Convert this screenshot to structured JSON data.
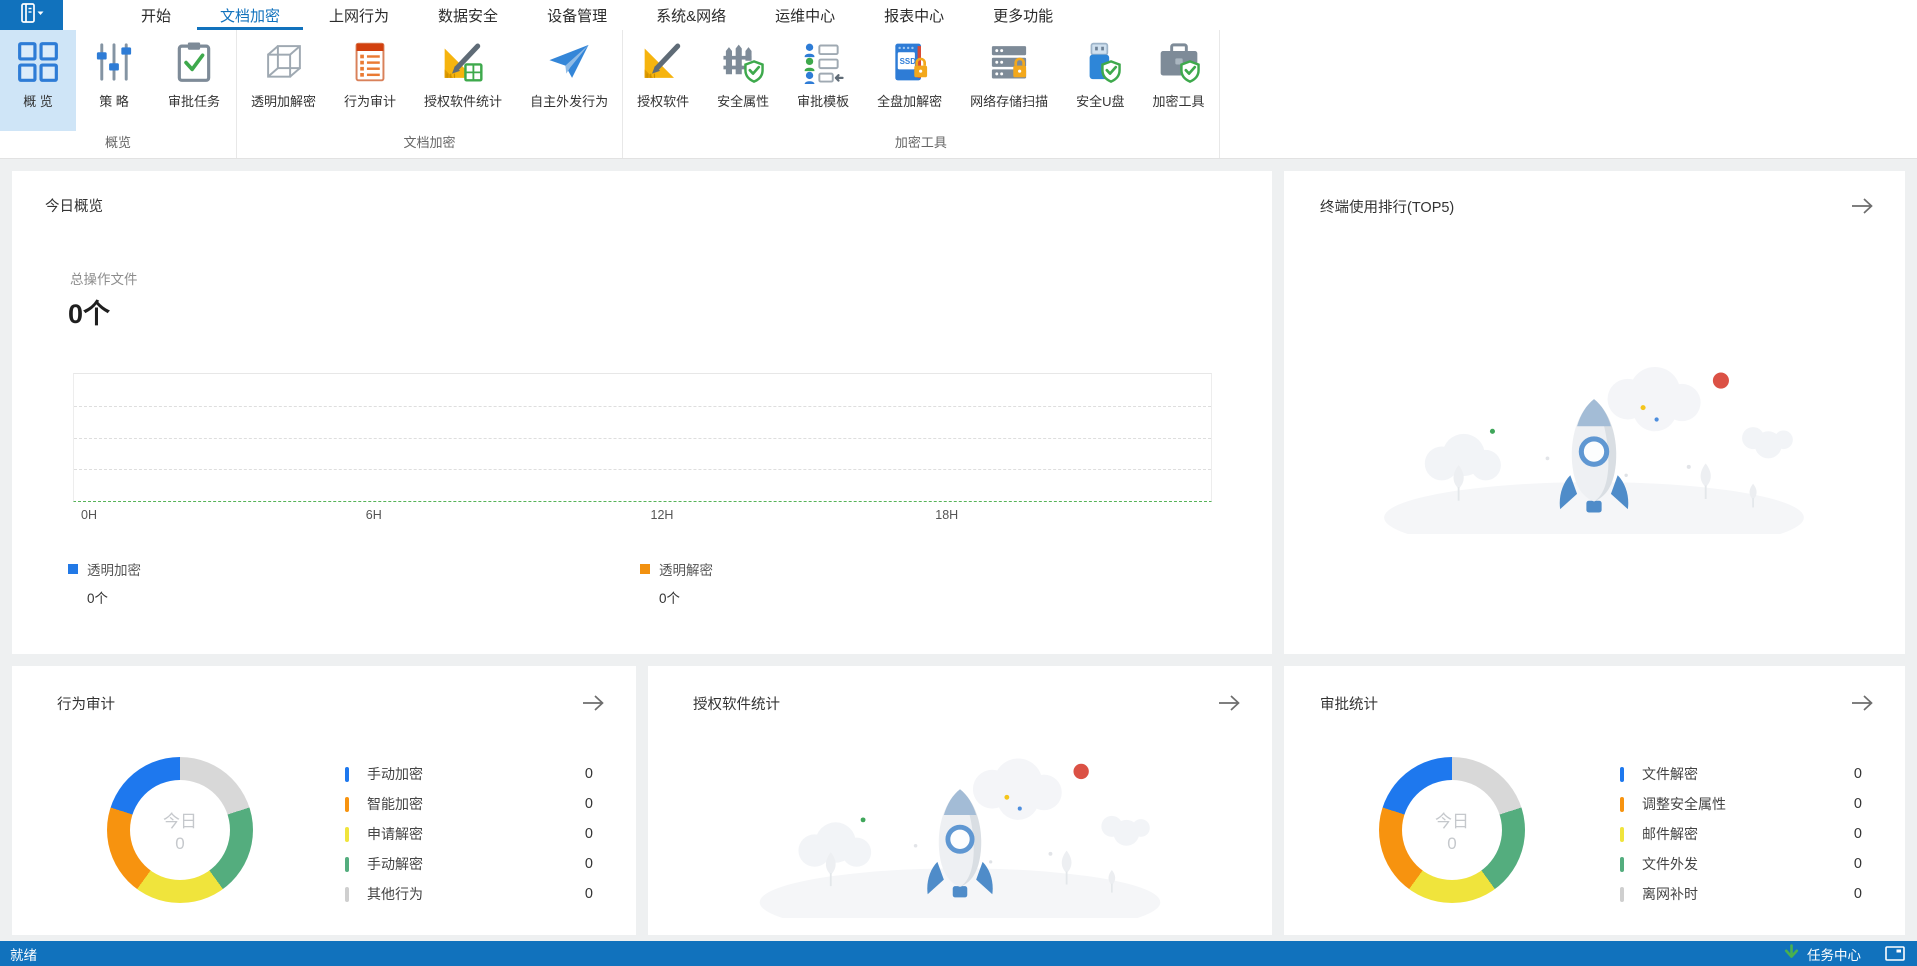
{
  "colors": {
    "accent_blue": "#1172bd",
    "ribbon_selected_bg": "#cfe5f7",
    "page_bg": "#eef0f1",
    "chart_baseline_green": "#56b358",
    "donut_blue": "#1e78ee",
    "donut_orange": "#f7930f",
    "donut_yellow": "#f0e43c",
    "donut_green": "#54ad7e",
    "donut_gray": "#d8d8d8",
    "empty_state_red_dot": "#db5145"
  },
  "menu": {
    "app_button": {
      "icon": "app-menu-icon"
    },
    "tabs": [
      {
        "name": "tab-start",
        "label": "开始",
        "active": false
      },
      {
        "name": "tab-doc-encryption",
        "label": "文档加密",
        "active": true
      },
      {
        "name": "tab-internet-behavior",
        "label": "上网行为",
        "active": false
      },
      {
        "name": "tab-data-security",
        "label": "数据安全",
        "active": false
      },
      {
        "name": "tab-device-mgmt",
        "label": "设备管理",
        "active": false
      },
      {
        "name": "tab-system-network",
        "label": "系统&网络",
        "active": false
      },
      {
        "name": "tab-ops-center",
        "label": "运维中心",
        "active": false
      },
      {
        "name": "tab-report-center",
        "label": "报表中心",
        "active": false
      },
      {
        "name": "tab-more-features",
        "label": "更多功能",
        "active": false
      }
    ]
  },
  "ribbon": {
    "groups": [
      {
        "label": "概览",
        "items": [
          {
            "name": "overview",
            "label": "概 览",
            "icon": "overview-icon",
            "selected": true
          },
          {
            "name": "policy",
            "label": "策 略",
            "icon": "policy-sliders-icon",
            "selected": false
          },
          {
            "name": "approval-task",
            "label": "审批任务",
            "icon": "approval-task-icon",
            "selected": false
          }
        ]
      },
      {
        "label": "文档加密",
        "items": [
          {
            "name": "transparent-crypt",
            "label": "透明加解密",
            "icon": "transparent-crypt-cube-icon",
            "selected": false
          },
          {
            "name": "behavior-audit",
            "label": "行为审计",
            "icon": "behavior-audit-doc-icon",
            "selected": false
          },
          {
            "name": "authorized-software-stats",
            "label": "授权软件统计",
            "icon": "authorized-software-stats-icon",
            "selected": false
          },
          {
            "name": "self-outgoing",
            "label": "自主外发行为",
            "icon": "outgoing-plane-icon",
            "selected": false
          }
        ]
      },
      {
        "label": "加密工具",
        "items": [
          {
            "name": "authorized-software",
            "label": "授权软件",
            "icon": "authorized-software-icon",
            "selected": false
          },
          {
            "name": "security-attribute",
            "label": "安全属性",
            "icon": "security-attribute-fence-icon",
            "selected": false
          },
          {
            "name": "approval-template",
            "label": "审批模板",
            "icon": "approval-template-icon",
            "selected": false
          },
          {
            "name": "full-disk-crypt",
            "label": "全盘加解密",
            "icon": "full-disk-crypt-icon",
            "selected": false
          },
          {
            "name": "network-storage-scan",
            "label": "网络存储扫描",
            "icon": "network-storage-scan-icon",
            "selected": false
          },
          {
            "name": "secure-usb",
            "label": "安全U盘",
            "icon": "secure-usb-icon",
            "selected": false
          },
          {
            "name": "crypt-tools",
            "label": "加密工具",
            "icon": "crypt-tools-icon",
            "selected": false
          }
        ]
      }
    ]
  },
  "cards": {
    "today_overview": {
      "title": "今日概览",
      "stat": {
        "label": "总操作文件",
        "value": "0个"
      },
      "chart": {
        "x_ticks": [
          "0H",
          "6H",
          "12H",
          "18H"
        ]
      },
      "legend": [
        {
          "label": "透明加密",
          "value": "0个",
          "color": "#2279e6"
        },
        {
          "label": "透明解密",
          "value": "0个",
          "color": "#f29110"
        }
      ]
    },
    "terminal_rank": {
      "title": "终端使用排行(TOP5)"
    },
    "behavior_audit": {
      "title": "行为审计",
      "donut": {
        "center_label": "今日",
        "center_value": "0",
        "segments": [
          {
            "color": "#d8d8d8",
            "sweep": 72
          },
          {
            "color": "#54ad7e",
            "sweep": 72
          },
          {
            "color": "#f0e43c",
            "sweep": 72
          },
          {
            "color": "#f7930f",
            "sweep": 72
          },
          {
            "color": "#1e78ee",
            "sweep": 72
          }
        ]
      },
      "legend": [
        {
          "label": "手动加密",
          "value": "0",
          "color": "#1e78ee"
        },
        {
          "label": "智能加密",
          "value": "0",
          "color": "#f7930f"
        },
        {
          "label": "申请解密",
          "value": "0",
          "color": "#f0e43c"
        },
        {
          "label": "手动解密",
          "value": "0",
          "color": "#54ad7e"
        },
        {
          "label": "其他行为",
          "value": "0",
          "color": "#cfcfcf"
        }
      ]
    },
    "software_stats": {
      "title": "授权软件统计"
    },
    "approval_stats": {
      "title": "审批统计",
      "donut": {
        "center_label": "今日",
        "center_value": "0",
        "segments": [
          {
            "color": "#d8d8d8",
            "sweep": 72
          },
          {
            "color": "#54ad7e",
            "sweep": 72
          },
          {
            "color": "#f0e43c",
            "sweep": 72
          },
          {
            "color": "#f7930f",
            "sweep": 72
          },
          {
            "color": "#1e78ee",
            "sweep": 72
          }
        ]
      },
      "legend": [
        {
          "label": "文件解密",
          "value": "0",
          "color": "#1e78ee"
        },
        {
          "label": "调整安全属性",
          "value": "0",
          "color": "#f7930f"
        },
        {
          "label": "邮件解密",
          "value": "0",
          "color": "#f0e43c"
        },
        {
          "label": "文件外发",
          "value": "0",
          "color": "#54ad7e"
        },
        {
          "label": "离网补时",
          "value": "0",
          "color": "#cfcfcf"
        }
      ]
    }
  },
  "statusbar": {
    "status_text": "就绪",
    "task_center_label": "任务中心"
  },
  "chart_data": [
    {
      "type": "line",
      "title": "今日概览",
      "xlabel": "hour of day",
      "x_ticks": [
        "0H",
        "6H",
        "12H",
        "18H"
      ],
      "x_range_hours": [
        0,
        24
      ],
      "series": [
        {
          "name": "透明加密",
          "values": [],
          "total": "0个"
        },
        {
          "name": "透明解密",
          "values": [],
          "total": "0个"
        }
      ],
      "grid": "horizontal-dashed",
      "note": "empty chart, flat green dashed baseline at zero, 总操作文件 = 0个"
    },
    {
      "type": "pie",
      "title": "行为审计",
      "center_label": "今日",
      "center_value": 0,
      "categories": [
        "手动加密",
        "智能加密",
        "申请解密",
        "手动解密",
        "其他行为"
      ],
      "values": [
        0,
        0,
        0,
        0,
        0
      ],
      "display": "five equal 72° placeholder segments (blue, orange, yellow, green, gray)"
    },
    {
      "type": "pie",
      "title": "审批统计",
      "center_label": "今日",
      "center_value": 0,
      "categories": [
        "文件解密",
        "调整安全属性",
        "邮件解密",
        "文件外发",
        "离网补时"
      ],
      "values": [
        0,
        0,
        0,
        0,
        0
      ],
      "display": "five equal 72° placeholder segments (blue, orange, yellow, green, gray)"
    }
  ]
}
